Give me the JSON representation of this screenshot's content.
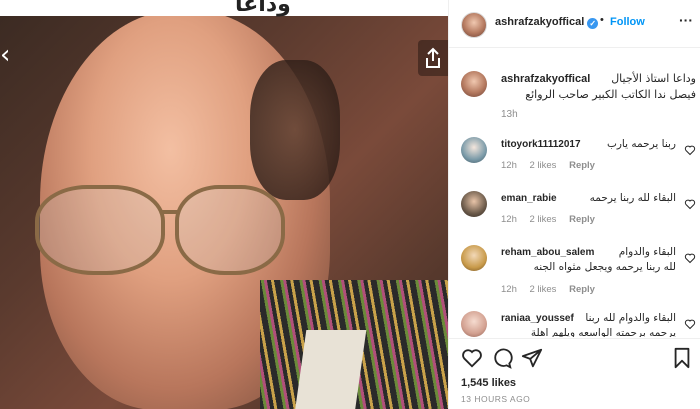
{
  "photo": {
    "top_caption": "وداعا"
  },
  "header": {
    "username": "ashrafzakyoffical",
    "separator": "•",
    "follow_label": "Follow",
    "more_label": "···"
  },
  "caption": {
    "username": "ashrafzakyoffical",
    "line1": "وداعا استاذ الأجيال",
    "line2": "فيصل ندا الكاتب الكبير صاحب الروائع",
    "time": "13h"
  },
  "comments": [
    {
      "username": "titoyork11112017",
      "text": "ربنا يرحمه يارب",
      "text2": "",
      "time": "12h",
      "likes": "2 likes",
      "reply": "Reply"
    },
    {
      "username": "eman_rabie",
      "text": "البقاء لله ربنا يرحمه",
      "text2": "",
      "time": "12h",
      "likes": "2 likes",
      "reply": "Reply"
    },
    {
      "username": "reham_abou_salem",
      "text": "البقاء والدوام",
      "text2": "لله ربنا يرحمه ويجعل مثواه الجنه",
      "time": "12h",
      "likes": "2 likes",
      "reply": "Reply"
    },
    {
      "username": "raniaa_youssef",
      "text": "البقاء والدوام لله ربنا",
      "text2": "يرحمه برحمته الواسعه ويلهم اهلة",
      "time": "",
      "likes": "",
      "reply": ""
    }
  ],
  "footer": {
    "likes": "1,545 likes",
    "ago": "13 HOURS AGO"
  }
}
